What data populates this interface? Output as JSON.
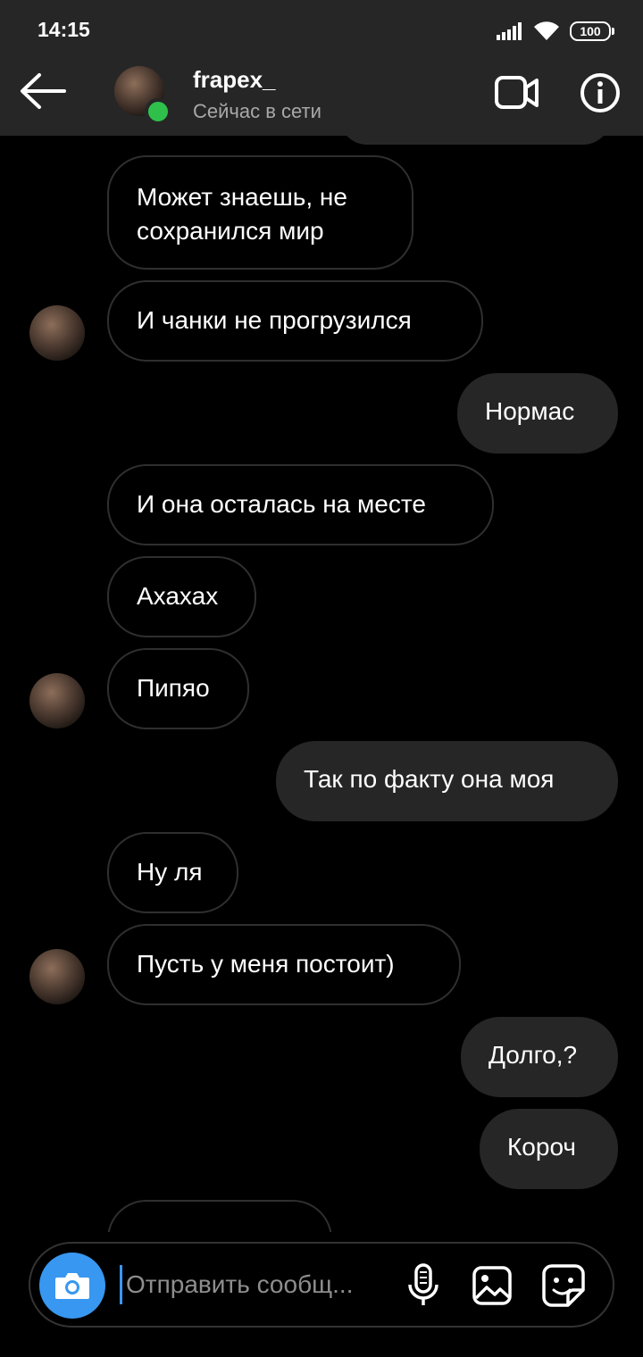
{
  "status_bar": {
    "time": "14:15",
    "battery": "100",
    "icons": [
      "signal-icon",
      "wifi-icon",
      "battery-icon"
    ]
  },
  "header": {
    "username": "frapex_",
    "presence": "Сейчас в сети",
    "icons": [
      "back-arrow-icon",
      "video-call-icon",
      "info-icon"
    ],
    "online_color": "#2fc04b"
  },
  "messages": [
    {
      "direction": "incoming",
      "text": "Может знаешь, не сохранился мир"
    },
    {
      "direction": "incoming",
      "text": "И чанки не прогрузился"
    },
    {
      "direction": "outgoing",
      "text": "Нормас"
    },
    {
      "direction": "incoming",
      "text": "И она осталась на месте"
    },
    {
      "direction": "incoming",
      "text": "Ахахах"
    },
    {
      "direction": "incoming",
      "text": "Пипяо"
    },
    {
      "direction": "outgoing",
      "text": "Так по факту она моя"
    },
    {
      "direction": "incoming",
      "text": "Ну ля"
    },
    {
      "direction": "incoming",
      "text": "Пусть у меня постоит)"
    },
    {
      "direction": "outgoing",
      "text": "Долго,?"
    },
    {
      "direction": "outgoing",
      "text": "Короч"
    }
  ],
  "composer": {
    "placeholder": "Отправить сообщ...",
    "icons": [
      "camera-icon",
      "microphone-icon",
      "gallery-icon",
      "sticker-icon"
    ],
    "accent": "#3897f0"
  },
  "colors": {
    "background": "#000000",
    "header": "#262626",
    "outgoing_bubble": "#262626",
    "incoming_border": "#2f2f2f"
  }
}
